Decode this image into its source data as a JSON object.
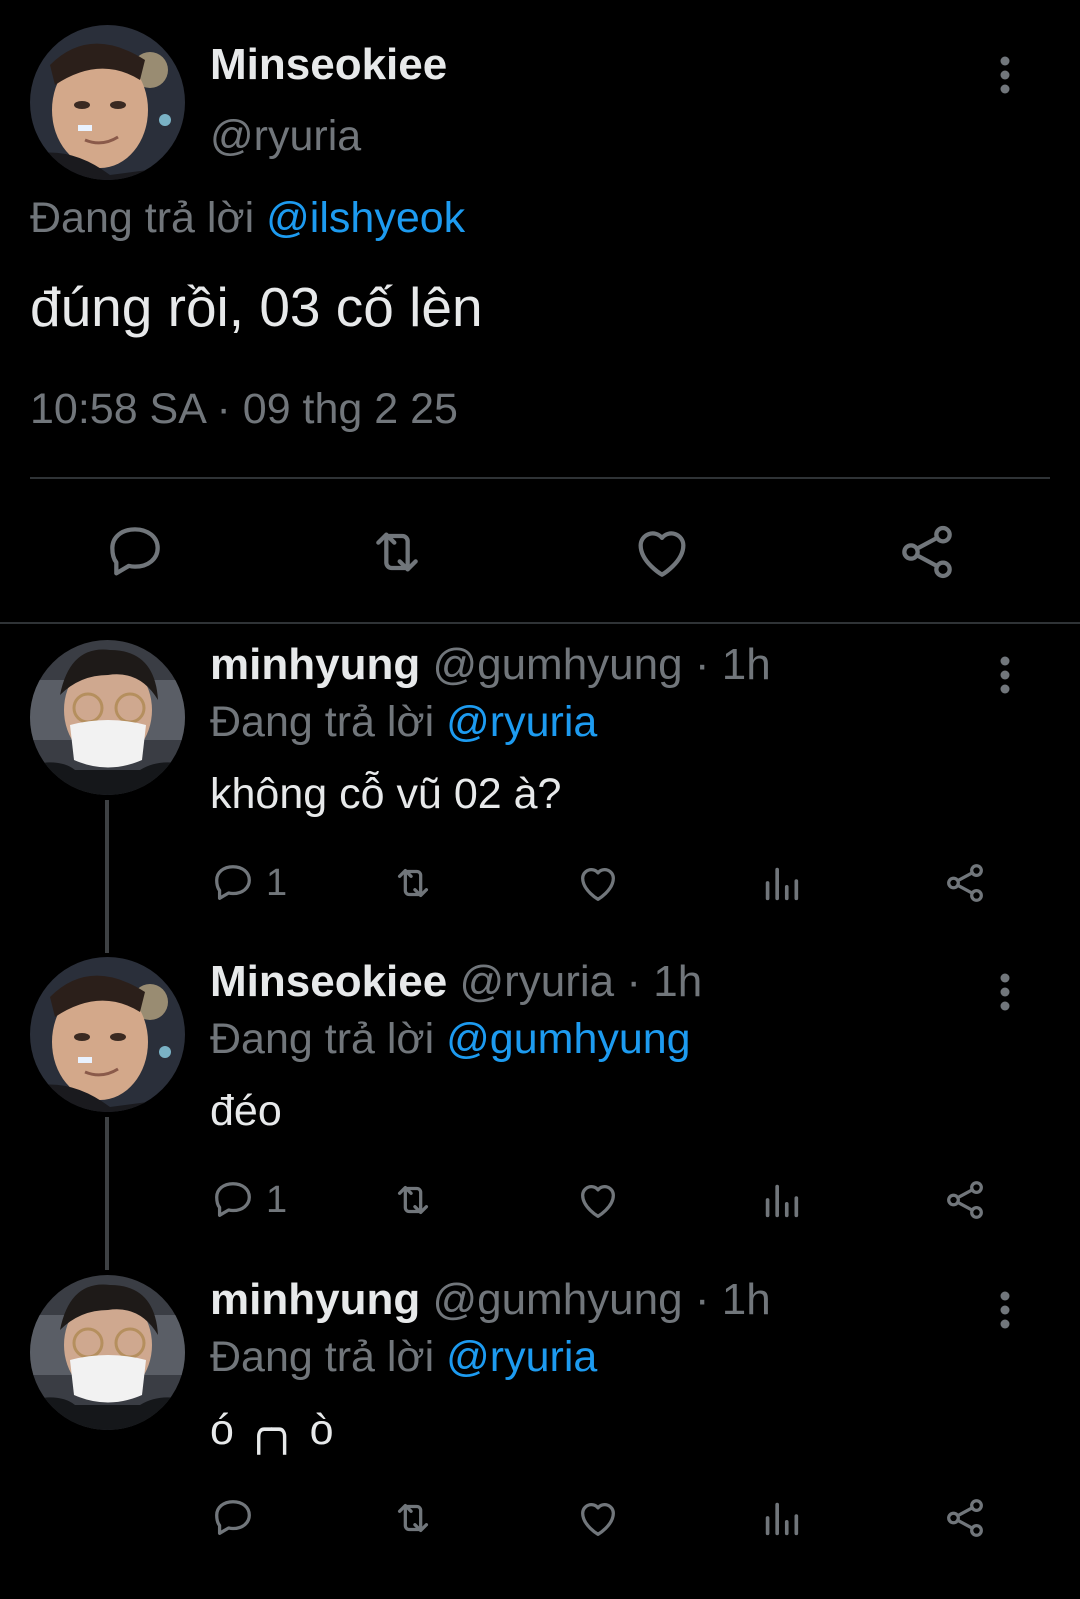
{
  "main_tweet": {
    "name": "Minseokiee",
    "handle": "@ryuria",
    "replying_prefix": "Đang trả lời",
    "replying_to": "@ilshyeok",
    "text": "đúng rồi, 03 cố lên",
    "time": "10:58 SA",
    "separator": "·",
    "date": "09 thg 2 25",
    "icons": [
      "reply-icon",
      "retweet-icon",
      "like-icon",
      "share-icon"
    ]
  },
  "replies": [
    {
      "name": "minhyung",
      "handle": "@gumhyung",
      "dot": "·",
      "time": "1h",
      "replying_prefix": "Đang trả lời",
      "replying_to": "@ryuria",
      "text": "không cỗ vũ 02 à?",
      "reply_count": "1"
    },
    {
      "name": "Minseokiee",
      "handle": "@ryuria",
      "dot": "·",
      "time": "1h",
      "replying_prefix": "Đang trả lời",
      "replying_to": "@gumhyung",
      "text": "đéo",
      "reply_count": "1"
    },
    {
      "name": "minhyung",
      "handle": "@gumhyung",
      "dot": "·",
      "time": "1h",
      "replying_prefix": "Đang trả lời",
      "replying_to": "@ryuria",
      "text": "ó ╭╮ ò",
      "reply_count": ""
    }
  ],
  "colors": {
    "background": "#000000",
    "text": "#e7e9ea",
    "muted": "#71767b",
    "link": "#1d9bf0",
    "divider": "#2f3336"
  }
}
